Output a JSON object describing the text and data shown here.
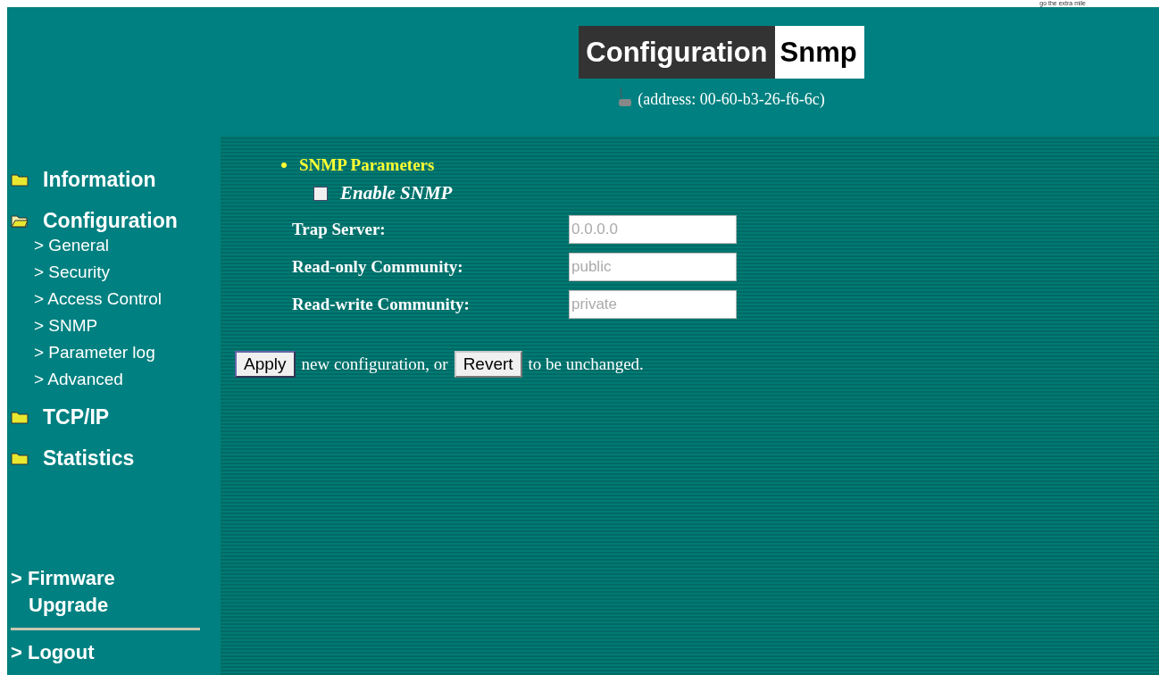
{
  "tagline": "go the extra mile",
  "header": {
    "title_primary": "Configuration",
    "title_secondary": "Snmp",
    "address": "(address: 00-60-b3-26-f6-6c)"
  },
  "sidebar": {
    "items": [
      {
        "label": "Information",
        "expanded": false
      },
      {
        "label": "Configuration",
        "expanded": true,
        "children": [
          {
            "label": "> General"
          },
          {
            "label": "> Security"
          },
          {
            "label": "> Access Control"
          },
          {
            "label": "> SNMP"
          },
          {
            "label": "> Parameter log"
          },
          {
            "label": "> Advanced"
          }
        ]
      },
      {
        "label": "TCP/IP",
        "expanded": false
      },
      {
        "label": "Statistics",
        "expanded": false
      }
    ],
    "bottom_links": [
      {
        "label": "> Firmware Upgrade"
      },
      {
        "label": "> Logout"
      }
    ]
  },
  "section": {
    "title": "SNMP Parameters",
    "checkbox": {
      "label": "Enable SNMP",
      "checked": false
    },
    "fields": [
      {
        "label": "Trap Server:",
        "value": "0.0.0.0",
        "disabled": true
      },
      {
        "label": "Read-only Community:",
        "value": "public",
        "disabled": true
      },
      {
        "label": "Read-write Community:",
        "value": "private",
        "disabled": true
      }
    ]
  },
  "actions": {
    "apply": "Apply",
    "middle": "new configuration, or",
    "revert": "Revert",
    "end": "to be unchanged."
  }
}
